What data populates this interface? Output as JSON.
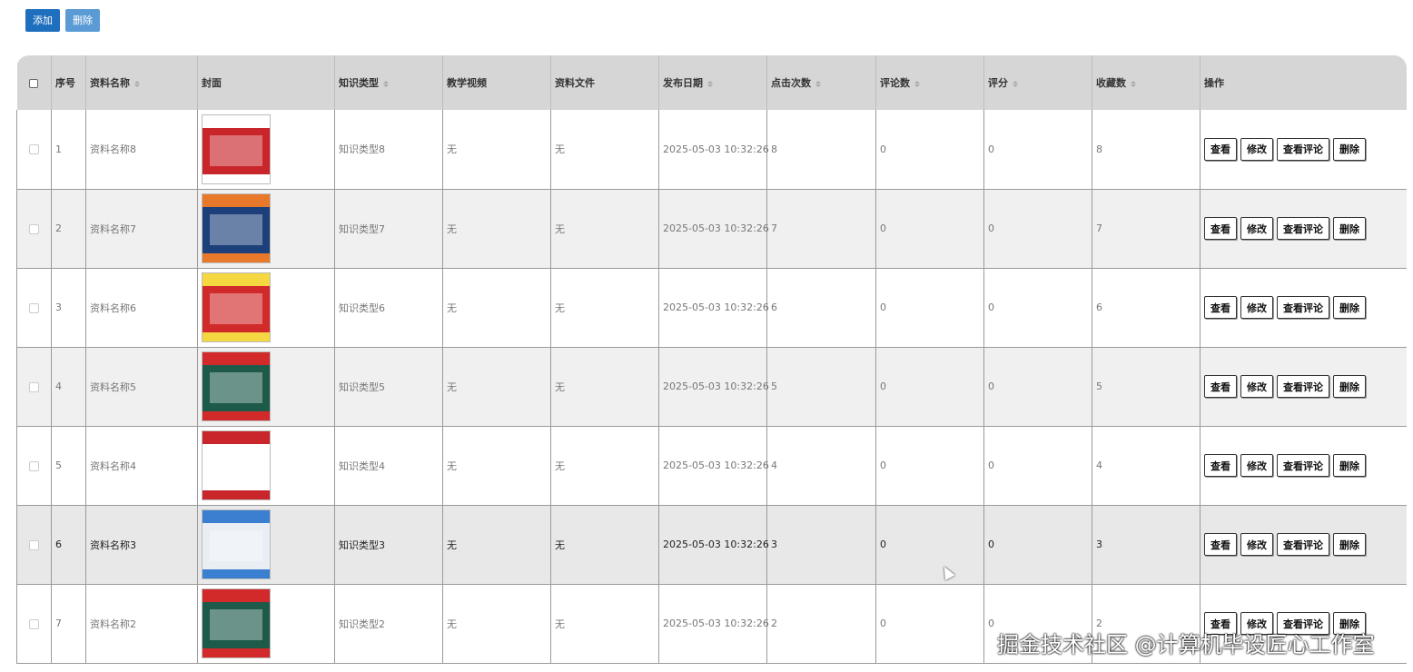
{
  "toolbar": {
    "add_label": "添加",
    "delete_label": "删除"
  },
  "table": {
    "headers": [
      "序号",
      "资料名称",
      "封面",
      "知识类型",
      "教学视频",
      "资料文件",
      "发布日期",
      "点击次数",
      "评论数",
      "评分",
      "收藏数",
      "操作"
    ],
    "rows": [
      {
        "index": "1",
        "name": "资料名称8",
        "type": "知识类型8",
        "video": "无",
        "file": "无",
        "date": "2025-05-03 10:32:26",
        "clicks": "8",
        "comments": "0",
        "score": "0",
        "favorites": "8",
        "cover_color": "#c8262a",
        "cover_accent": "#ffffff"
      },
      {
        "index": "2",
        "name": "资料名称7",
        "type": "知识类型7",
        "video": "无",
        "file": "无",
        "date": "2025-05-03 10:32:26",
        "clicks": "7",
        "comments": "0",
        "score": "0",
        "favorites": "7",
        "cover_color": "#1d3f7a",
        "cover_accent": "#e8782a"
      },
      {
        "index": "3",
        "name": "资料名称6",
        "type": "知识类型6",
        "video": "无",
        "file": "无",
        "date": "2025-05-03 10:32:26",
        "clicks": "6",
        "comments": "0",
        "score": "0",
        "favorites": "6",
        "cover_color": "#d12a2a",
        "cover_accent": "#f5d742"
      },
      {
        "index": "4",
        "name": "资料名称5",
        "type": "知识类型5",
        "video": "无",
        "file": "无",
        "date": "2025-05-03 10:32:26",
        "clicks": "5",
        "comments": "0",
        "score": "0",
        "favorites": "5",
        "cover_color": "#1e5a4a",
        "cover_accent": "#d22a2a"
      },
      {
        "index": "5",
        "name": "资料名称4",
        "type": "知识类型4",
        "video": "无",
        "file": "无",
        "date": "2025-05-03 10:32:26",
        "clicks": "4",
        "comments": "0",
        "score": "0",
        "favorites": "4",
        "cover_color": "#ffffff",
        "cover_accent": "#c8262a"
      },
      {
        "index": "6",
        "name": "资料名称3",
        "type": "知识类型3",
        "video": "无",
        "file": "无",
        "date": "2025-05-03 10:32:26",
        "clicks": "3",
        "comments": "0",
        "score": "0",
        "favorites": "3",
        "cover_color": "#e9eef4",
        "cover_accent": "#3b7fd0"
      },
      {
        "index": "7",
        "name": "资料名称2",
        "type": "知识类型2",
        "video": "无",
        "file": "无",
        "date": "2025-05-03 10:32:26",
        "clicks": "2",
        "comments": "0",
        "score": "0",
        "favorites": "2",
        "cover_color": "#1e5a4a",
        "cover_accent": "#d22a2a"
      }
    ],
    "row_actions": [
      "查看",
      "修改",
      "查看评论",
      "删除"
    ]
  },
  "watermark": "掘金技术社区 @计算机毕设匠心工作室"
}
